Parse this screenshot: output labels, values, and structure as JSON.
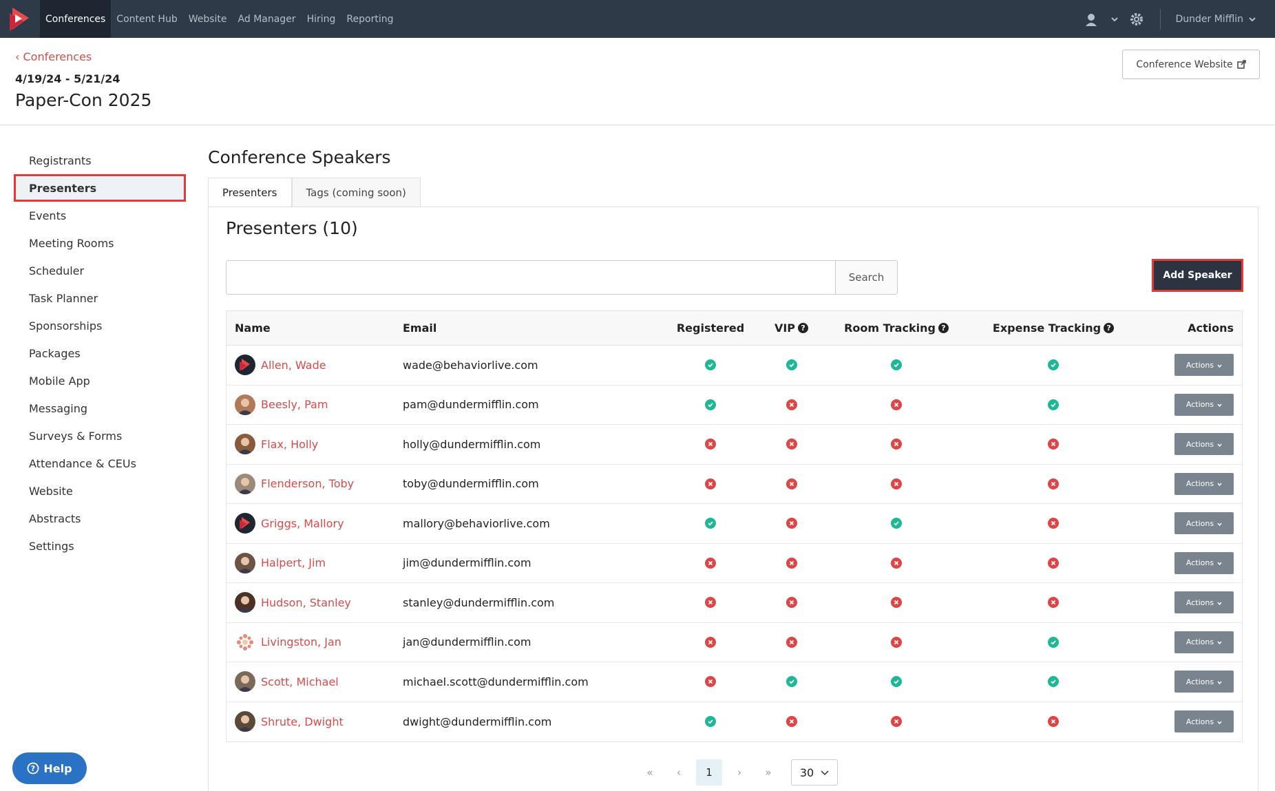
{
  "nav": {
    "links": [
      "Conferences",
      "Content Hub",
      "Website",
      "Ad Manager",
      "Hiring",
      "Reporting"
    ],
    "active": "Conferences",
    "org": "Dunder Mifflin"
  },
  "header": {
    "back": "Conferences",
    "dates": "4/19/24 - 5/21/24",
    "name": "Paper-Con 2025",
    "website_button": "Conference Website"
  },
  "sidebar": {
    "items": [
      "Registrants",
      "Presenters",
      "Events",
      "Meeting Rooms",
      "Scheduler",
      "Task Planner",
      "Sponsorships",
      "Packages",
      "Mobile App",
      "Messaging",
      "Surveys & Forms",
      "Attendance & CEUs",
      "Website",
      "Abstracts",
      "Settings"
    ],
    "active": "Presenters"
  },
  "main": {
    "title": "Conference Speakers",
    "tabs": [
      "Presenters",
      "Tags (coming soon)"
    ],
    "panel_title": "Presenters (10)",
    "search_button": "Search",
    "search_placeholder": "",
    "add_button": "Add Speaker"
  },
  "table": {
    "headers": [
      "Name",
      "Email",
      "Registered",
      "VIP",
      "Room Tracking",
      "Expense Tracking",
      "Actions"
    ],
    "action_label": "Actions",
    "rows": [
      {
        "name": "Allen, Wade",
        "email": "wade@behaviorlive.com",
        "registered": true,
        "vip": true,
        "room": true,
        "expense": true,
        "avatar": "logo"
      },
      {
        "name": "Beesly, Pam",
        "email": "pam@dundermifflin.com",
        "registered": true,
        "vip": false,
        "room": false,
        "expense": true,
        "avatar": "#b07a5a"
      },
      {
        "name": "Flax, Holly",
        "email": "holly@dundermifflin.com",
        "registered": false,
        "vip": false,
        "room": false,
        "expense": false,
        "avatar": "#8a5a3c"
      },
      {
        "name": "Flenderson, Toby",
        "email": "toby@dundermifflin.com",
        "registered": false,
        "vip": false,
        "room": false,
        "expense": false,
        "avatar": "#9a8a7a"
      },
      {
        "name": "Griggs, Mallory",
        "email": "mallory@behaviorlive.com",
        "registered": true,
        "vip": false,
        "room": true,
        "expense": false,
        "avatar": "logo"
      },
      {
        "name": "Halpert, Jim",
        "email": "jim@dundermifflin.com",
        "registered": false,
        "vip": false,
        "room": false,
        "expense": false,
        "avatar": "#6b5444"
      },
      {
        "name": "Hudson, Stanley",
        "email": "stanley@dundermifflin.com",
        "registered": false,
        "vip": false,
        "room": false,
        "expense": false,
        "avatar": "#4a3326"
      },
      {
        "name": "Livingston, Jan",
        "email": "jan@dundermifflin.com",
        "registered": false,
        "vip": false,
        "room": false,
        "expense": true,
        "avatar": "flower"
      },
      {
        "name": "Scott, Michael",
        "email": "michael.scott@dundermifflin.com",
        "registered": false,
        "vip": true,
        "room": true,
        "expense": true,
        "avatar": "#7a6a5a"
      },
      {
        "name": "Shrute, Dwight",
        "email": "dwight@dundermifflin.com",
        "registered": true,
        "vip": false,
        "room": false,
        "expense": false,
        "avatar": "#5a4a3a"
      }
    ]
  },
  "pagination": {
    "first": "«",
    "prev": "‹",
    "current": "1",
    "next": "›",
    "last": "»",
    "per_page": "30"
  },
  "help": "Help",
  "colors": {
    "nav_bg": "#2f3a48",
    "accent_red": "#d94a4a",
    "highlight_border": "#e53935",
    "check_green": "#1fb896",
    "cross_red": "#e04545",
    "help_blue": "#2a73c4"
  }
}
